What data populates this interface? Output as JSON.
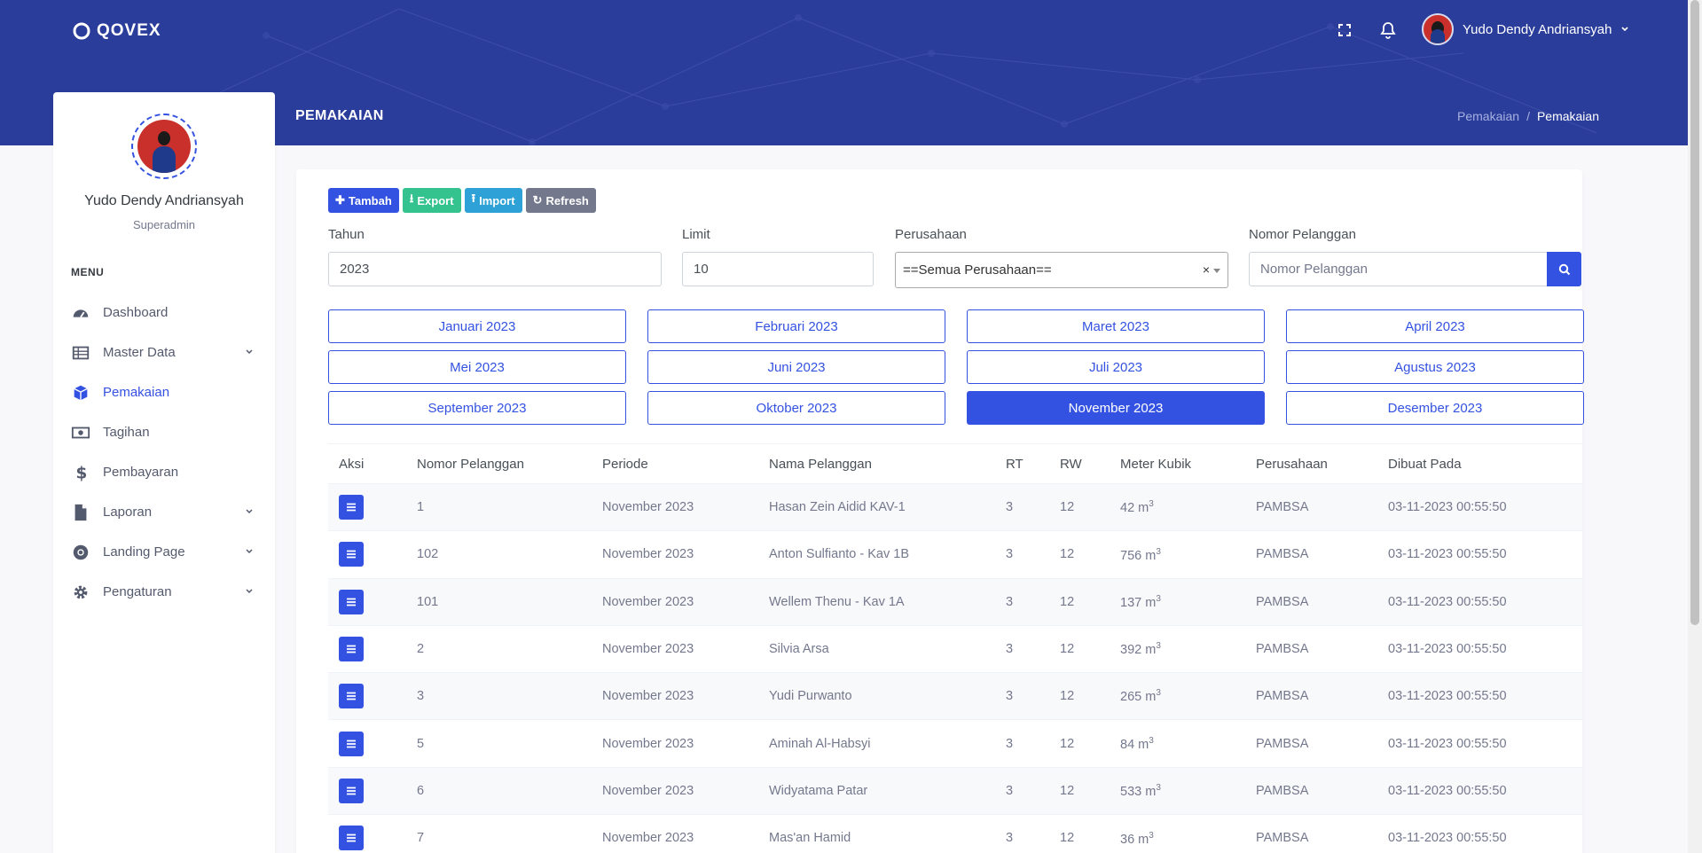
{
  "app": {
    "logo_text": "QOVEX"
  },
  "topbar": {
    "user_name": "Yudo Dendy Andriansyah",
    "fullscreen_icon": "fullscreen-icon",
    "bell_icon": "bell-icon"
  },
  "page": {
    "title": "PEMAKAIAN",
    "breadcrumb": [
      "Pemakaian",
      "/",
      "Pemakaian"
    ]
  },
  "sidebar": {
    "profile_name": "Yudo Dendy Andriansyah",
    "profile_role": "Superadmin",
    "menu_title": "MENU",
    "items": [
      {
        "label": "Dashboard",
        "icon": "dashboard-icon"
      },
      {
        "label": "Master Data",
        "icon": "table-icon"
      },
      {
        "label": "Pemakaian",
        "icon": "cube-icon"
      },
      {
        "label": "Tagihan",
        "icon": "money-icon"
      },
      {
        "label": "Pembayaran",
        "icon": "dollar-icon"
      },
      {
        "label": "Laporan",
        "icon": "file-icon"
      },
      {
        "label": "Landing Page",
        "icon": "chrome-icon"
      },
      {
        "label": "Pengaturan",
        "icon": "gear-icon"
      }
    ]
  },
  "toolbar": {
    "tambah": "Tambah",
    "export": "Export",
    "import": "Import",
    "refresh": "Refresh"
  },
  "filters": {
    "tahun_label": "Tahun",
    "tahun_value": "2023",
    "limit_label": "Limit",
    "limit_value": "10",
    "perusahaan_label": "Perusahaan",
    "perusahaan_value": "==Semua Perusahaan==",
    "nomor_label": "Nomor Pelanggan",
    "nomor_placeholder": "Nomor Pelanggan"
  },
  "months": [
    "Januari 2023",
    "Februari 2023",
    "Maret 2023",
    "April 2023",
    "Mei 2023",
    "Juni 2023",
    "Juli 2023",
    "Agustus 2023",
    "September 2023",
    "Oktober 2023",
    "November 2023",
    "Desember 2023"
  ],
  "active_month": "November 2023",
  "table": {
    "headers": [
      "Aksi",
      "Nomor Pelanggan",
      "Periode",
      "Nama Pelanggan",
      "RT",
      "RW",
      "Meter Kubik",
      "Perusahaan",
      "Dibuat Pada"
    ],
    "unit": "m",
    "unit_sup": "3",
    "rows": [
      {
        "nomor": "1",
        "periode": "November 2023",
        "nama": "Hasan Zein Aidid KAV-1",
        "rt": "3",
        "rw": "12",
        "meter": "42",
        "perusahaan": "PAMBSA",
        "dibuat": "03-11-2023 00:55:50"
      },
      {
        "nomor": "102",
        "periode": "November 2023",
        "nama": "Anton Sulfianto - Kav 1B",
        "rt": "3",
        "rw": "12",
        "meter": "756",
        "perusahaan": "PAMBSA",
        "dibuat": "03-11-2023 00:55:50"
      },
      {
        "nomor": "101",
        "periode": "November 2023",
        "nama": "Wellem Thenu - Kav 1A",
        "rt": "3",
        "rw": "12",
        "meter": "137",
        "perusahaan": "PAMBSA",
        "dibuat": "03-11-2023 00:55:50"
      },
      {
        "nomor": "2",
        "periode": "November 2023",
        "nama": "Silvia Arsa",
        "rt": "3",
        "rw": "12",
        "meter": "392",
        "perusahaan": "PAMBSA",
        "dibuat": "03-11-2023 00:55:50"
      },
      {
        "nomor": "3",
        "periode": "November 2023",
        "nama": "Yudi Purwanto",
        "rt": "3",
        "rw": "12",
        "meter": "265",
        "perusahaan": "PAMBSA",
        "dibuat": "03-11-2023 00:55:50"
      },
      {
        "nomor": "5",
        "periode": "November 2023",
        "nama": "Aminah Al-Habsyi",
        "rt": "3",
        "rw": "12",
        "meter": "84",
        "perusahaan": "PAMBSA",
        "dibuat": "03-11-2023 00:55:50"
      },
      {
        "nomor": "6",
        "periode": "November 2023",
        "nama": "Widyatama Patar",
        "rt": "3",
        "rw": "12",
        "meter": "533",
        "perusahaan": "PAMBSA",
        "dibuat": "03-11-2023 00:55:50"
      },
      {
        "nomor": "7",
        "periode": "November 2023",
        "nama": "Mas'an Hamid",
        "rt": "3",
        "rw": "12",
        "meter": "36",
        "perusahaan": "PAMBSA",
        "dibuat": "03-11-2023 00:55:50"
      }
    ]
  },
  "colors": {
    "primary": "#3452e1",
    "header": "#2b3d9b",
    "success": "#34c38f",
    "info": "#2ea1d6",
    "secondary": "#74788d"
  }
}
